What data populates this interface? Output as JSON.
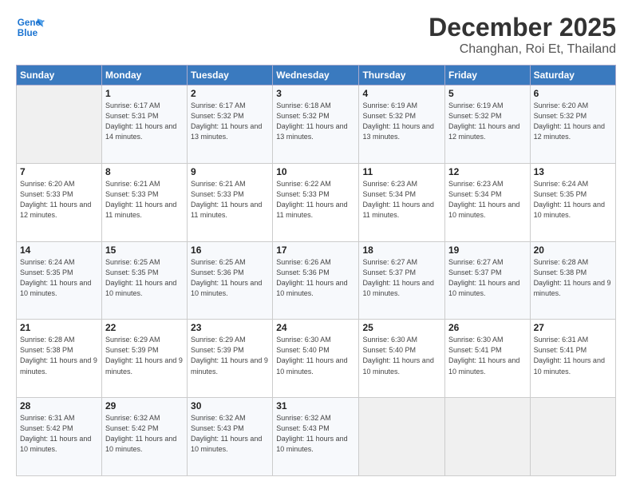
{
  "logo": {
    "line1": "General",
    "line2": "Blue"
  },
  "title": "December 2025",
  "location": "Changhan, Roi Et, Thailand",
  "weekdays": [
    "Sunday",
    "Monday",
    "Tuesday",
    "Wednesday",
    "Thursday",
    "Friday",
    "Saturday"
  ],
  "weeks": [
    [
      {
        "day": "",
        "sunrise": "",
        "sunset": "",
        "daylight": ""
      },
      {
        "day": "1",
        "sunrise": "Sunrise: 6:17 AM",
        "sunset": "Sunset: 5:31 PM",
        "daylight": "Daylight: 11 hours and 14 minutes."
      },
      {
        "day": "2",
        "sunrise": "Sunrise: 6:17 AM",
        "sunset": "Sunset: 5:32 PM",
        "daylight": "Daylight: 11 hours and 13 minutes."
      },
      {
        "day": "3",
        "sunrise": "Sunrise: 6:18 AM",
        "sunset": "Sunset: 5:32 PM",
        "daylight": "Daylight: 11 hours and 13 minutes."
      },
      {
        "day": "4",
        "sunrise": "Sunrise: 6:19 AM",
        "sunset": "Sunset: 5:32 PM",
        "daylight": "Daylight: 11 hours and 13 minutes."
      },
      {
        "day": "5",
        "sunrise": "Sunrise: 6:19 AM",
        "sunset": "Sunset: 5:32 PM",
        "daylight": "Daylight: 11 hours and 12 minutes."
      },
      {
        "day": "6",
        "sunrise": "Sunrise: 6:20 AM",
        "sunset": "Sunset: 5:32 PM",
        "daylight": "Daylight: 11 hours and 12 minutes."
      }
    ],
    [
      {
        "day": "7",
        "sunrise": "Sunrise: 6:20 AM",
        "sunset": "Sunset: 5:33 PM",
        "daylight": "Daylight: 11 hours and 12 minutes."
      },
      {
        "day": "8",
        "sunrise": "Sunrise: 6:21 AM",
        "sunset": "Sunset: 5:33 PM",
        "daylight": "Daylight: 11 hours and 11 minutes."
      },
      {
        "day": "9",
        "sunrise": "Sunrise: 6:21 AM",
        "sunset": "Sunset: 5:33 PM",
        "daylight": "Daylight: 11 hours and 11 minutes."
      },
      {
        "day": "10",
        "sunrise": "Sunrise: 6:22 AM",
        "sunset": "Sunset: 5:33 PM",
        "daylight": "Daylight: 11 hours and 11 minutes."
      },
      {
        "day": "11",
        "sunrise": "Sunrise: 6:23 AM",
        "sunset": "Sunset: 5:34 PM",
        "daylight": "Daylight: 11 hours and 11 minutes."
      },
      {
        "day": "12",
        "sunrise": "Sunrise: 6:23 AM",
        "sunset": "Sunset: 5:34 PM",
        "daylight": "Daylight: 11 hours and 10 minutes."
      },
      {
        "day": "13",
        "sunrise": "Sunrise: 6:24 AM",
        "sunset": "Sunset: 5:35 PM",
        "daylight": "Daylight: 11 hours and 10 minutes."
      }
    ],
    [
      {
        "day": "14",
        "sunrise": "Sunrise: 6:24 AM",
        "sunset": "Sunset: 5:35 PM",
        "daylight": "Daylight: 11 hours and 10 minutes."
      },
      {
        "day": "15",
        "sunrise": "Sunrise: 6:25 AM",
        "sunset": "Sunset: 5:35 PM",
        "daylight": "Daylight: 11 hours and 10 minutes."
      },
      {
        "day": "16",
        "sunrise": "Sunrise: 6:25 AM",
        "sunset": "Sunset: 5:36 PM",
        "daylight": "Daylight: 11 hours and 10 minutes."
      },
      {
        "day": "17",
        "sunrise": "Sunrise: 6:26 AM",
        "sunset": "Sunset: 5:36 PM",
        "daylight": "Daylight: 11 hours and 10 minutes."
      },
      {
        "day": "18",
        "sunrise": "Sunrise: 6:27 AM",
        "sunset": "Sunset: 5:37 PM",
        "daylight": "Daylight: 11 hours and 10 minutes."
      },
      {
        "day": "19",
        "sunrise": "Sunrise: 6:27 AM",
        "sunset": "Sunset: 5:37 PM",
        "daylight": "Daylight: 11 hours and 10 minutes."
      },
      {
        "day": "20",
        "sunrise": "Sunrise: 6:28 AM",
        "sunset": "Sunset: 5:38 PM",
        "daylight": "Daylight: 11 hours and 9 minutes."
      }
    ],
    [
      {
        "day": "21",
        "sunrise": "Sunrise: 6:28 AM",
        "sunset": "Sunset: 5:38 PM",
        "daylight": "Daylight: 11 hours and 9 minutes."
      },
      {
        "day": "22",
        "sunrise": "Sunrise: 6:29 AM",
        "sunset": "Sunset: 5:39 PM",
        "daylight": "Daylight: 11 hours and 9 minutes."
      },
      {
        "day": "23",
        "sunrise": "Sunrise: 6:29 AM",
        "sunset": "Sunset: 5:39 PM",
        "daylight": "Daylight: 11 hours and 9 minutes."
      },
      {
        "day": "24",
        "sunrise": "Sunrise: 6:30 AM",
        "sunset": "Sunset: 5:40 PM",
        "daylight": "Daylight: 11 hours and 10 minutes."
      },
      {
        "day": "25",
        "sunrise": "Sunrise: 6:30 AM",
        "sunset": "Sunset: 5:40 PM",
        "daylight": "Daylight: 11 hours and 10 minutes."
      },
      {
        "day": "26",
        "sunrise": "Sunrise: 6:30 AM",
        "sunset": "Sunset: 5:41 PM",
        "daylight": "Daylight: 11 hours and 10 minutes."
      },
      {
        "day": "27",
        "sunrise": "Sunrise: 6:31 AM",
        "sunset": "Sunset: 5:41 PM",
        "daylight": "Daylight: 11 hours and 10 minutes."
      }
    ],
    [
      {
        "day": "28",
        "sunrise": "Sunrise: 6:31 AM",
        "sunset": "Sunset: 5:42 PM",
        "daylight": "Daylight: 11 hours and 10 minutes."
      },
      {
        "day": "29",
        "sunrise": "Sunrise: 6:32 AM",
        "sunset": "Sunset: 5:42 PM",
        "daylight": "Daylight: 11 hours and 10 minutes."
      },
      {
        "day": "30",
        "sunrise": "Sunrise: 6:32 AM",
        "sunset": "Sunset: 5:43 PM",
        "daylight": "Daylight: 11 hours and 10 minutes."
      },
      {
        "day": "31",
        "sunrise": "Sunrise: 6:32 AM",
        "sunset": "Sunset: 5:43 PM",
        "daylight": "Daylight: 11 hours and 10 minutes."
      },
      {
        "day": "",
        "sunrise": "",
        "sunset": "",
        "daylight": ""
      },
      {
        "day": "",
        "sunrise": "",
        "sunset": "",
        "daylight": ""
      },
      {
        "day": "",
        "sunrise": "",
        "sunset": "",
        "daylight": ""
      }
    ]
  ]
}
